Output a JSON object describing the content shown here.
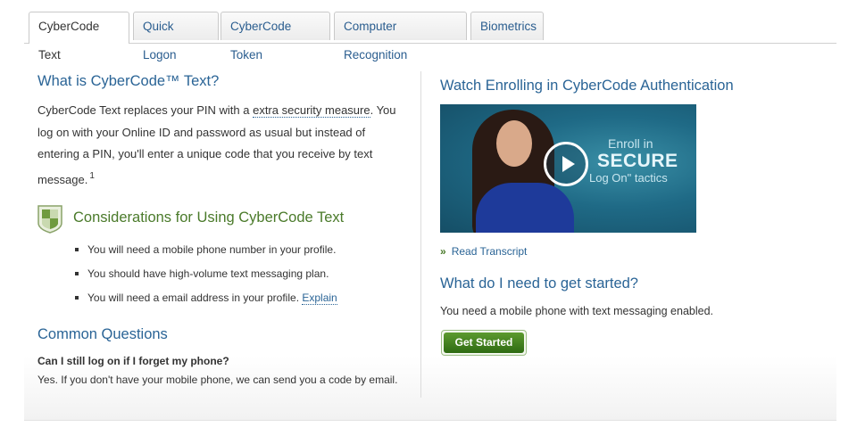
{
  "tabs": [
    {
      "label": "CyberCode Text",
      "active": true
    },
    {
      "label": "Quick Logon",
      "active": false
    },
    {
      "label": "CyberCode Token",
      "active": false
    },
    {
      "label": "Computer Recognition",
      "active": false
    },
    {
      "label": "Biometrics",
      "active": false
    }
  ],
  "left": {
    "what_title": "What is CyberCode™ Text?",
    "intro_before": "CyberCode Text replaces your PIN with a ",
    "intro_link": "extra security measure",
    "intro_after": ". You log on with your Online ID and password as usual but instead of entering a PIN, you'll enter a unique code that you receive by text message.",
    "intro_footnote": "1",
    "considerations_title": "Considerations for Using CyberCode Text",
    "considerations_icon": "shield-icon",
    "bullets": [
      "You will need a mobile phone number in your profile.",
      "You should have high-volume text messaging plan.",
      "You will need a email address in your profile. "
    ],
    "explain_link": "Explain",
    "common_title": "Common Questions",
    "question": "Can I still log on if I forget my phone?",
    "answer": "Yes. If you don't have your mobile phone, we can send you a code by email."
  },
  "right": {
    "video_title": "Watch Enrolling in CyberCode Authentication",
    "video_overlay_line1": "Enroll in",
    "video_overlay_line2": "SECURE",
    "video_overlay_line3": "Log On\" tactics",
    "play_icon": "play-icon",
    "transcript_chevron": "»",
    "transcript_link": "Read Transcript",
    "started_title": "What do I need to get started?",
    "started_text": "You need a mobile phone with text messaging enabled.",
    "get_started_button": "Get Started"
  },
  "colors": {
    "link_blue": "#2a6496",
    "heading_green": "#4a7a2a",
    "button_green": "#2e6b12"
  }
}
